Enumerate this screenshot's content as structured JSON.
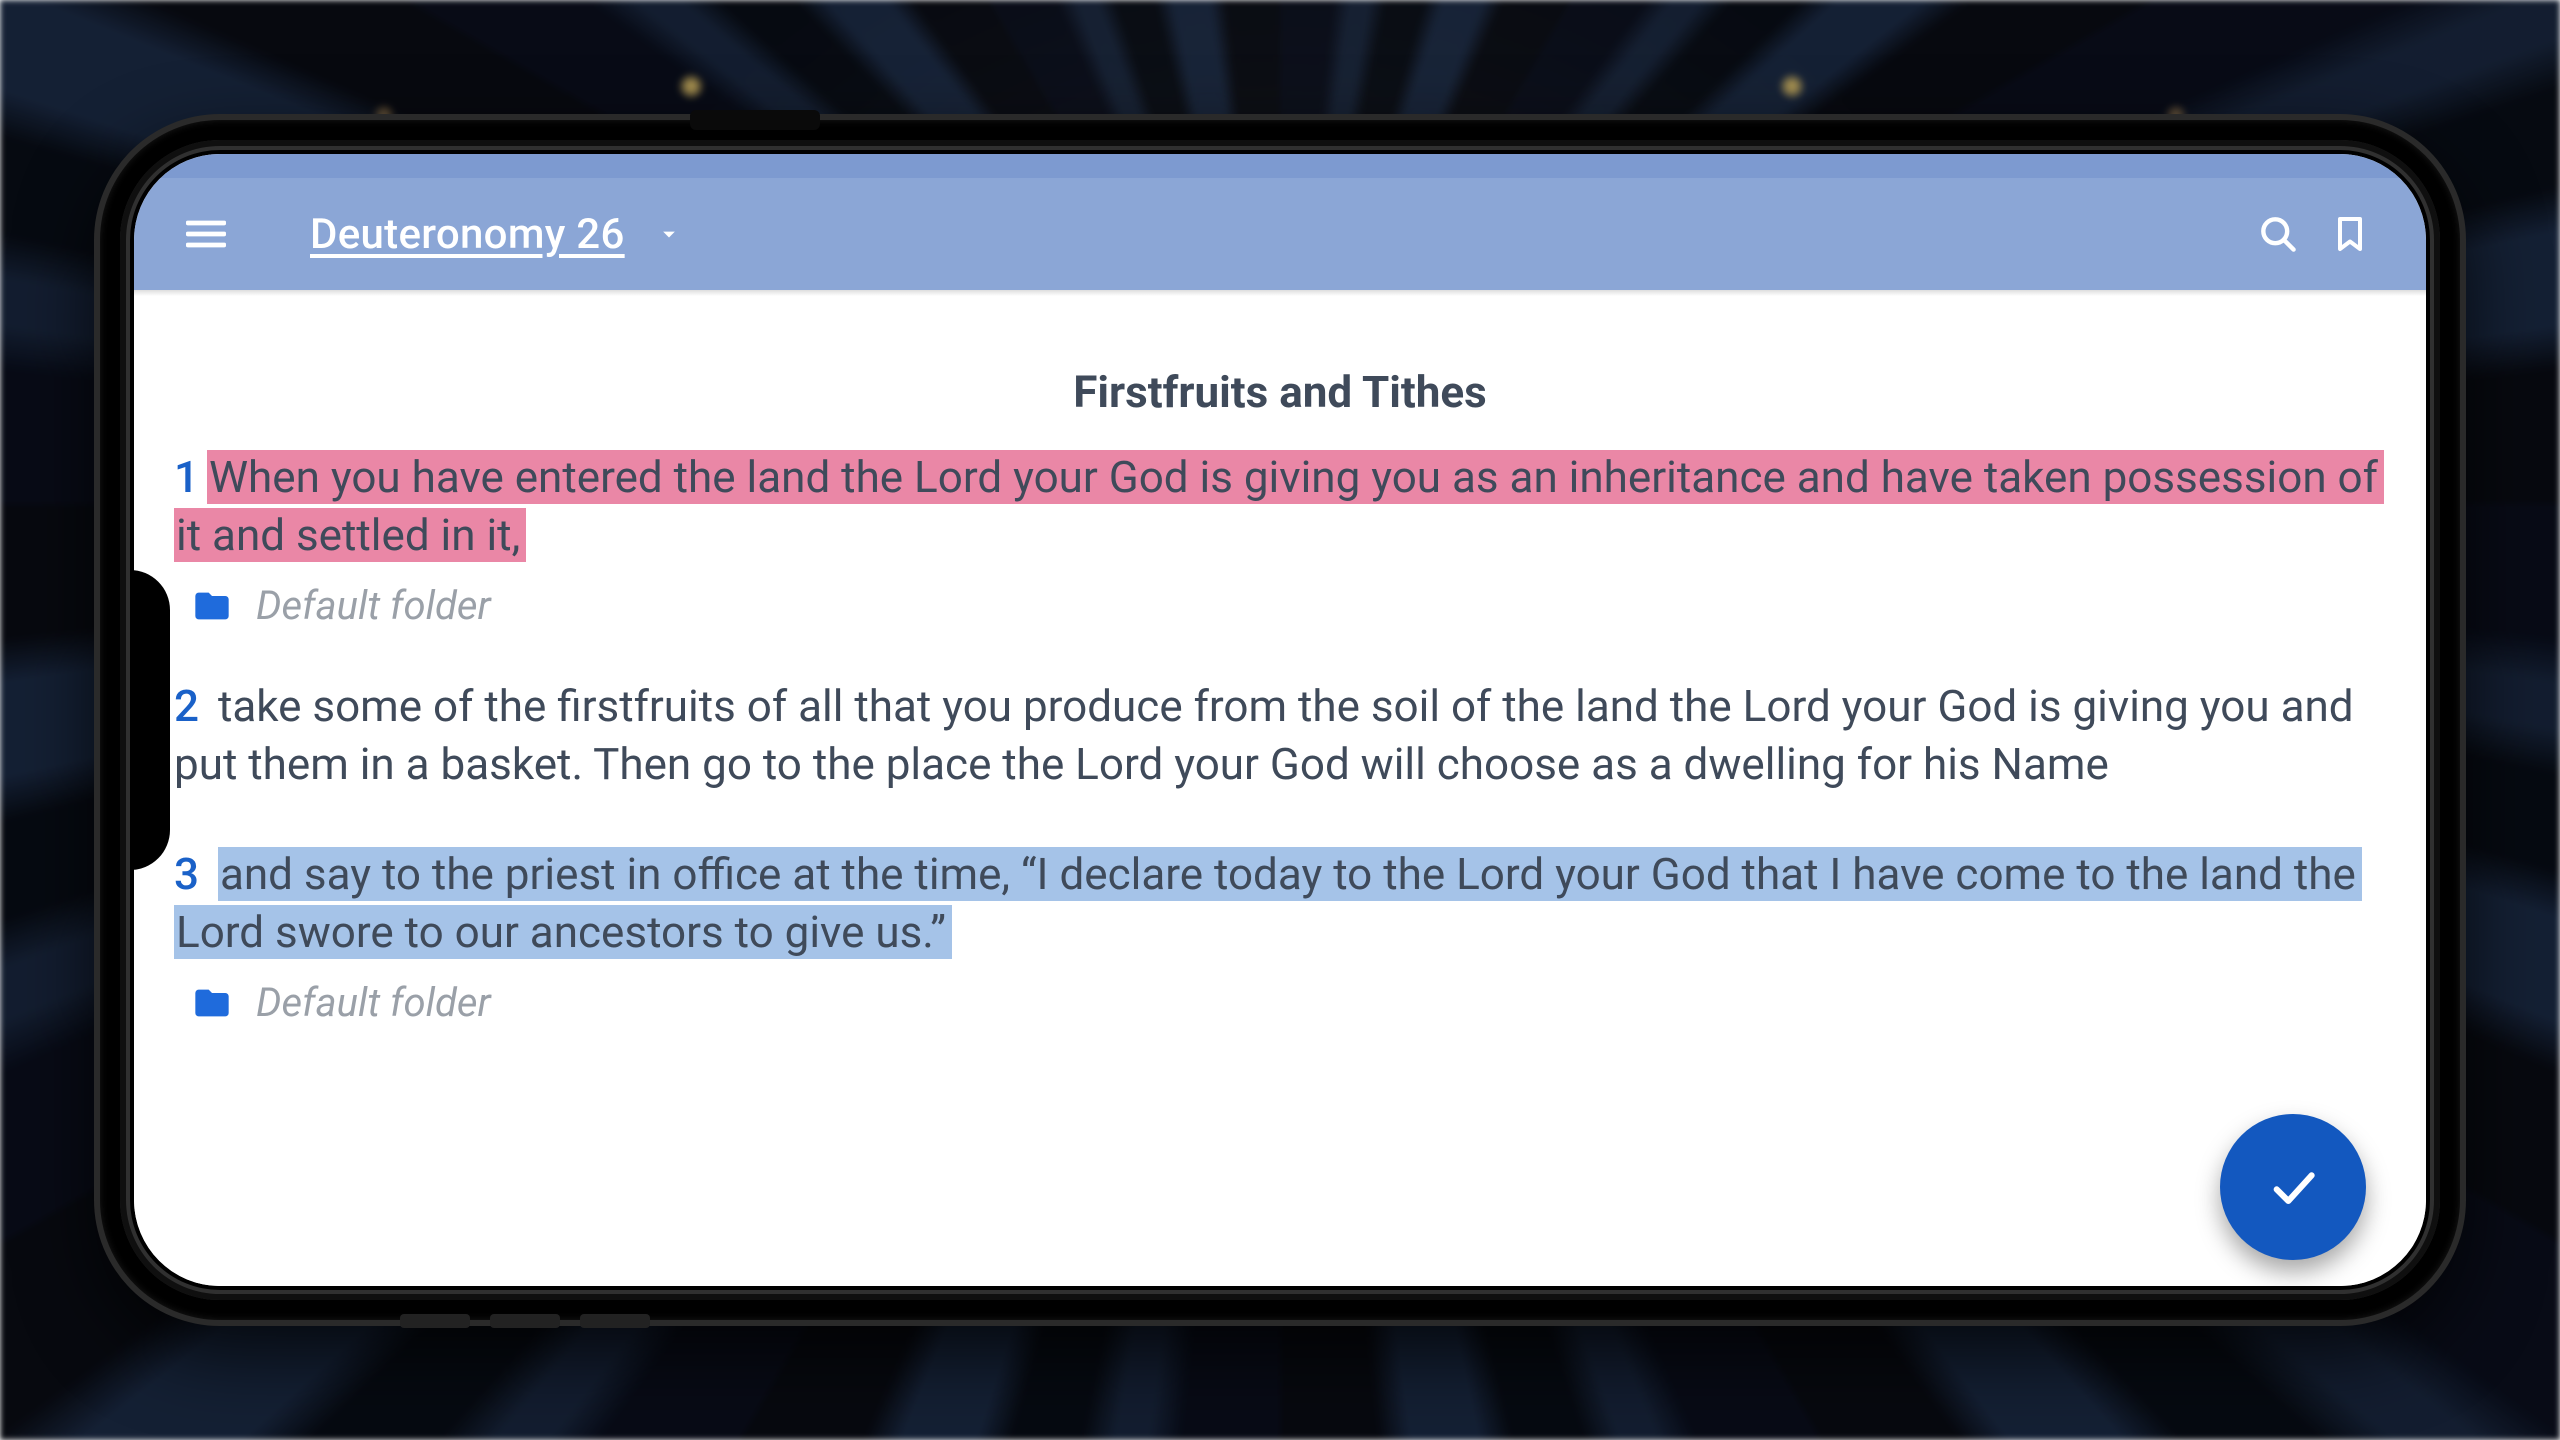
{
  "appbar": {
    "title": "Deuteronomy 26"
  },
  "section_title": "Firstfruits and Tithes",
  "verses": [
    {
      "num": "1",
      "text": "When you have entered the land the Lord your God is giving you as an inheritance and have taken possession of it and settled in it, ",
      "highlight": "pink",
      "folder": "Default folder"
    },
    {
      "num": "2",
      "text": "take some of the firstfruits of all that you produce from the soil of the land the Lord your God is giving you and put them in a basket. Then go to the place the Lord your God will choose as a dwelling for his Name",
      "highlight": null,
      "folder": null
    },
    {
      "num": "3",
      "text": "and say to the priest in office at the time, “I declare today to the Lord your God that I have come to the land the Lord swore to our ancestors to give us.” ",
      "highlight": "blue",
      "folder": "Default folder"
    }
  ],
  "folder_icon_name": "folder-icon",
  "fab": {
    "label": "confirm"
  }
}
